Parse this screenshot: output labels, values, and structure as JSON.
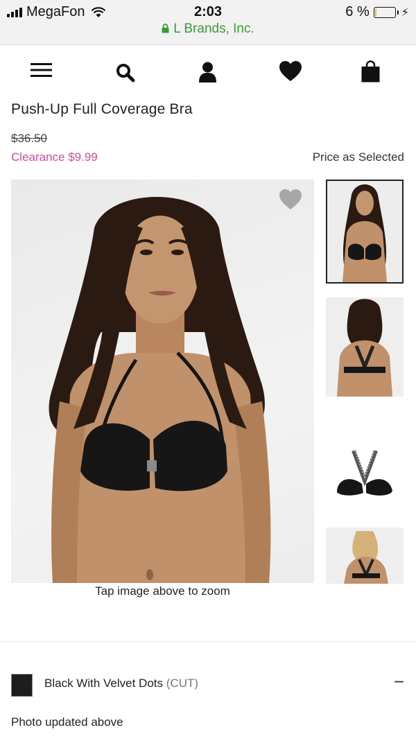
{
  "status_bar": {
    "carrier": "MegaFon",
    "time": "2:03",
    "url": "L Brands, Inc.",
    "battery_percent": "6 %",
    "battery_level": 0.06,
    "icons": [
      "signal-icon",
      "wifi-icon",
      "lock-icon",
      "battery-icon",
      "charging-icon"
    ]
  },
  "nav": {
    "icons": [
      "menu-icon",
      "search-icon",
      "account-icon",
      "heart-icon",
      "bag-icon"
    ]
  },
  "product": {
    "title": "Push-Up Full Coverage Bra",
    "original_price": "$36.50",
    "clearance_price": "Clearance $9.99",
    "price_note": "Price as Selected",
    "zoom_hint": "Tap image above to zoom",
    "color_name": "Black With Velvet Dots",
    "color_code": "(CUT)",
    "collapse_symbol": "−",
    "photo_note": "Photo updated above"
  },
  "colors": {
    "clearance": "#cc4c9a",
    "secure_url": "#3a9a3a",
    "swatch": "#1d1d1d",
    "battery_fill": "#f1c40f"
  }
}
